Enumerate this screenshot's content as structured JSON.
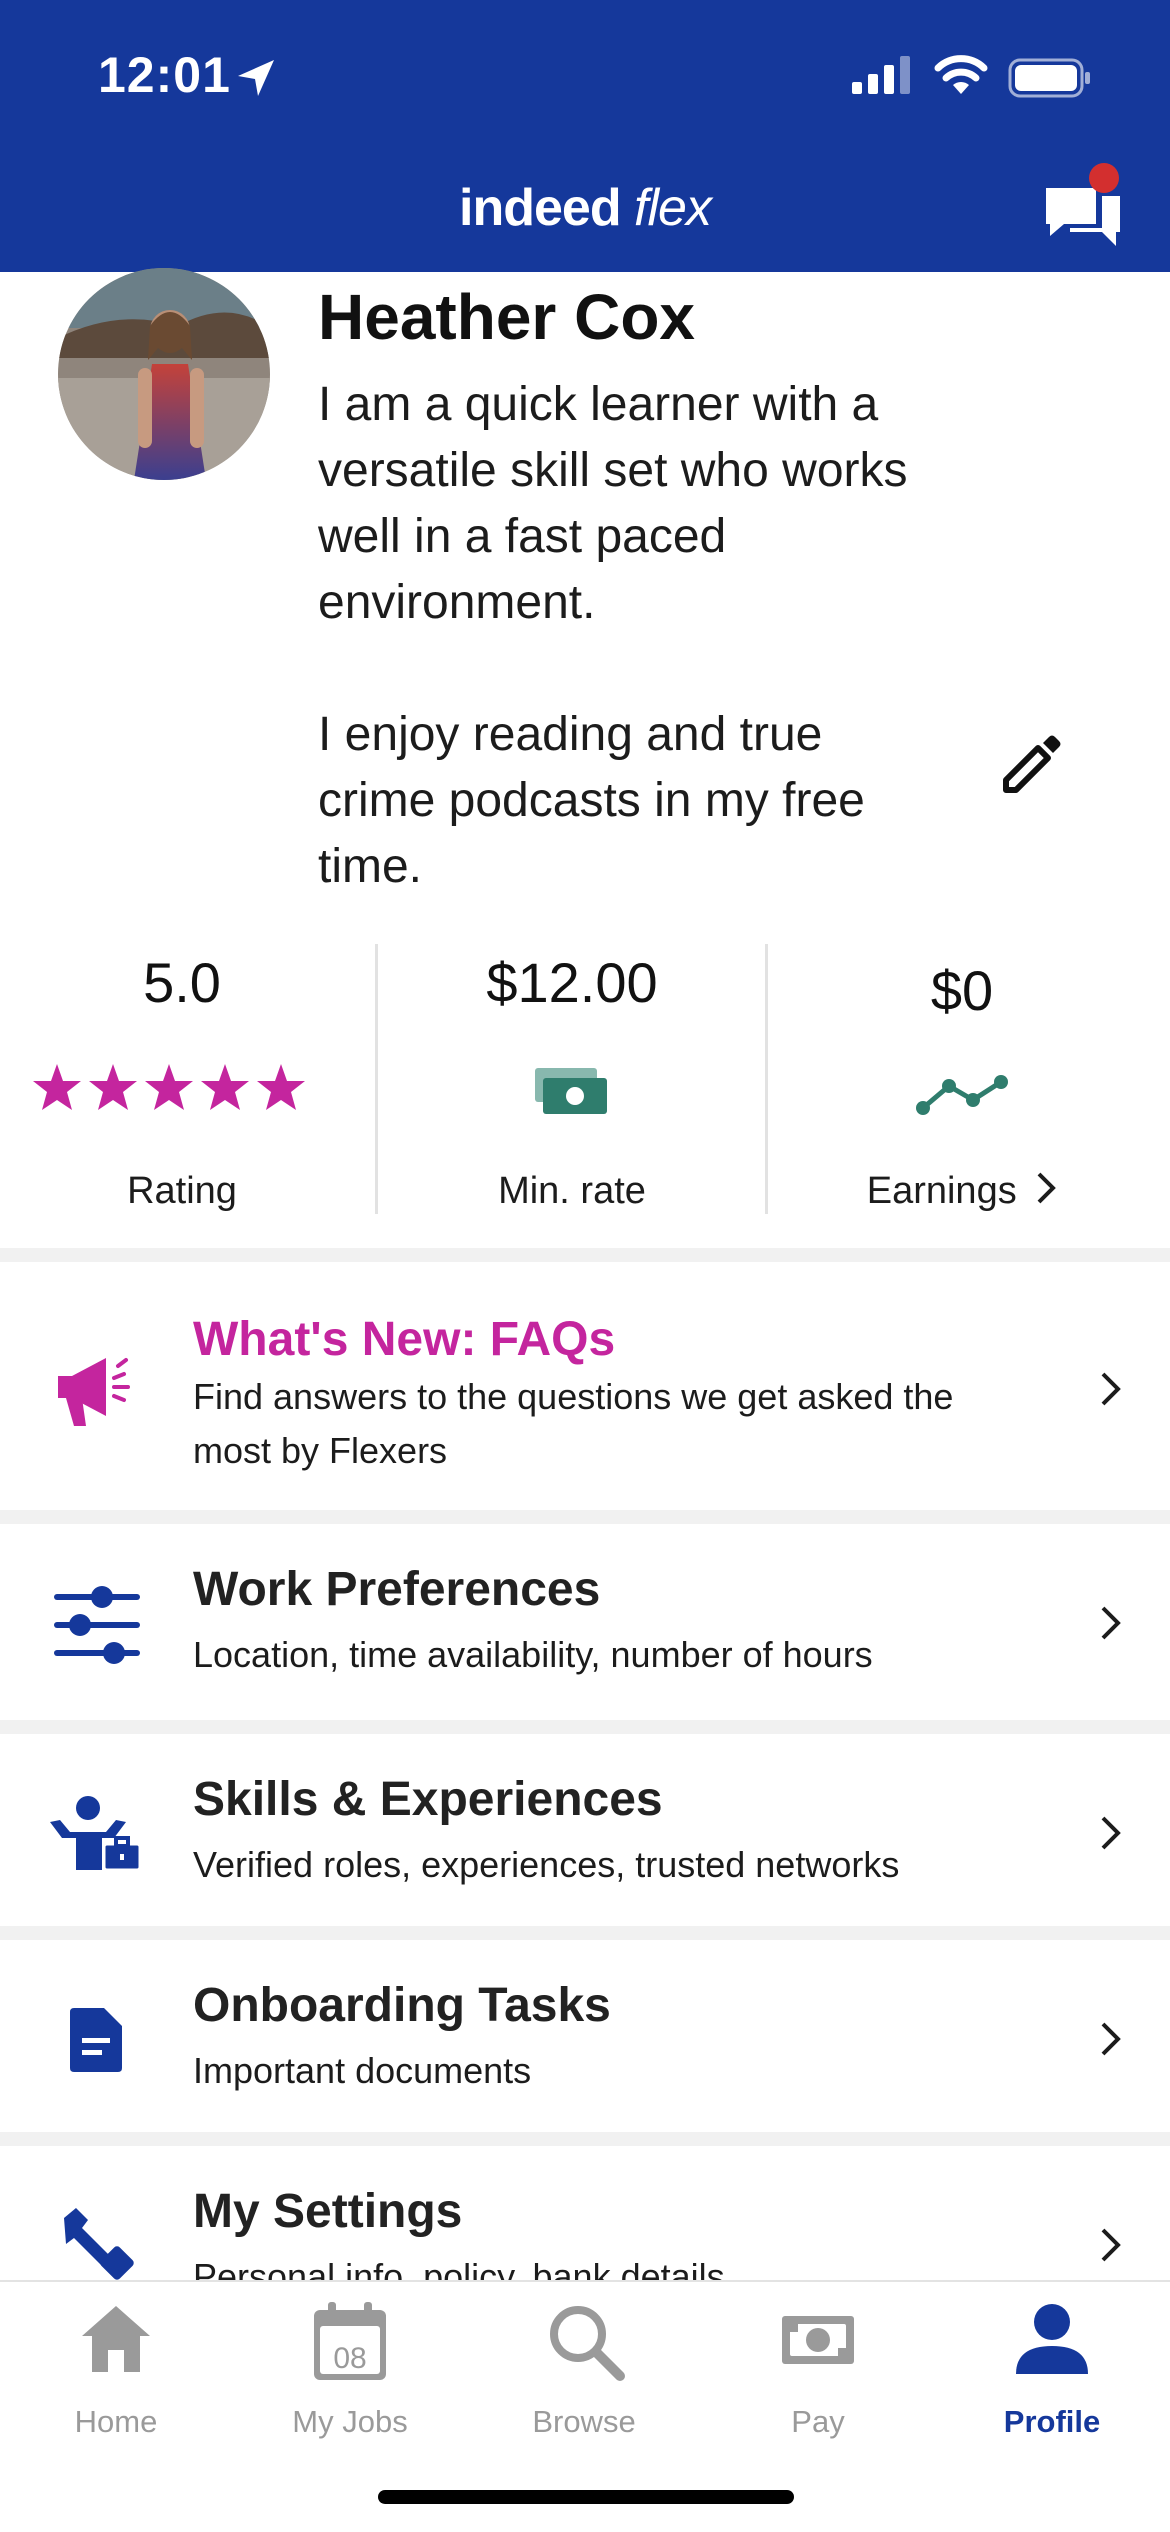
{
  "status_bar": {
    "time": "12:01"
  },
  "header": {
    "logo_main": "indeed",
    "logo_flex": "flex"
  },
  "profile": {
    "name": "Heather Cox",
    "bio": "I am a quick learner with a\nversatile skill set who works\nwell in a fast paced\nenvironment.\n\nI enjoy reading and true\ncrime podcasts in my free\ntime."
  },
  "stats": {
    "rating": {
      "value": "5.0",
      "label": "Rating",
      "stars": 5
    },
    "min_rate": {
      "value": "$12.00",
      "label": "Min. rate"
    },
    "earnings": {
      "value": "$0",
      "label": "Earnings"
    }
  },
  "menu": {
    "whats_new": {
      "title": "What's New: FAQs",
      "subtitle": "Find answers to the questions we get asked the\nmost by Flexers"
    },
    "work_preferences": {
      "title": "Work Preferences",
      "subtitle": "Location, time availability, number of hours"
    },
    "skills": {
      "title": "Skills & Experiences",
      "subtitle": "Verified roles, experiences, trusted networks"
    },
    "onboarding": {
      "title": "Onboarding Tasks",
      "subtitle": "Important documents"
    },
    "settings": {
      "title": "My Settings",
      "subtitle": "Personal info, policy, bank details"
    }
  },
  "tabs": {
    "home": "Home",
    "my_jobs": "My Jobs",
    "my_jobs_date": "08",
    "browse": "Browse",
    "pay": "Pay",
    "profile": "Profile"
  },
  "colors": {
    "brand_blue": "#15389b",
    "magenta": "#c4259e",
    "teal": "#2f7d6d",
    "inactive_gray": "#9a9a9a"
  }
}
